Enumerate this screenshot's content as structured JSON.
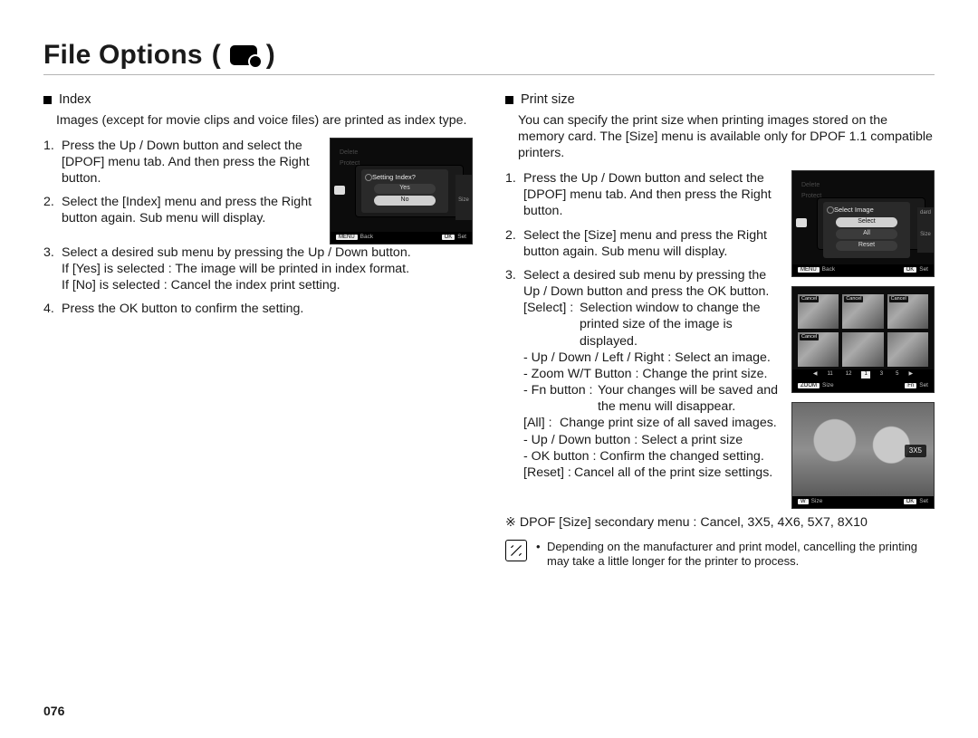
{
  "page_number": "076",
  "title": "File Options",
  "title_paren_open": "(",
  "title_paren_close": ")",
  "left": {
    "heading": "Index",
    "intro": "Images (except for movie clips and voice files) are printed as index type.",
    "s1": "Press the Up / Down button and select the [DPOF] menu tab. And then press the Right button.",
    "s2": "Select the [Index] menu and press the Right button again. Sub menu will display.",
    "s3": "Select a desired sub menu by pressing the Up / Down button.",
    "s3yes": "If [Yes] is selected : The image will be printed in index format.",
    "s3no": "If [No] is selected   : Cancel the index print setting.",
    "s4": "Press the OK button to confirm the setting.",
    "shot": {
      "faded1": "Delete",
      "faded2": "Protect",
      "dialog_title": "Setting Index?",
      "opt_yes": "Yes",
      "opt_no": "No",
      "right_label": "Size",
      "back": "Back",
      "set": "Set",
      "badge_menu": "MENU",
      "badge_ok": "OK"
    }
  },
  "right": {
    "heading": "Print size",
    "intro": "You can specify the print size when printing images stored on the memory card. The [Size] menu is available only for DPOF 1.1 compatible printers.",
    "s1": "Press the Up / Down button and select the [DPOF] menu tab. And then press the Right button.",
    "s2": "Select the [Size] menu and press the Right button again. Sub menu will display.",
    "s3": "Select a desired sub menu by pressing the Up / Down button and press the OK button.",
    "s3_select_label": "[Select] :",
    "s3_select_text": "Selection window to change the printed size of the image is displayed.",
    "s3_b1": "- Up / Down / Left / Right : Select an image.",
    "s3_b2": "- Zoom W/T Button : Change the print size.",
    "s3_b3_a": "- Fn button :",
    "s3_b3_b": "Your changes will be saved and the menu will disappear.",
    "s3_all_label": "[All] :",
    "s3_all_text": "Change print size of all saved images.",
    "s3_c1": "- Up / Down button : Select a print size",
    "s3_c2": "- OK button : Confirm the changed setting.",
    "s3_reset_label": "[Reset] :",
    "s3_reset_text": "Cancel all of the print size settings.",
    "secondary": "※ DPOF [Size] secondary menu : Cancel, 3X5, 4X6, 5X7, 8X10",
    "note": "Depending on the manufacturer and print model, cancelling the printing may take a little longer for the printer to process.",
    "shot1": {
      "faded1": "Delete",
      "faded2": "Protect",
      "dialog_title": "Select Image",
      "opt_select": "Select",
      "opt_all": "All",
      "opt_reset": "Reset",
      "right1": "dard",
      "right2": "Size",
      "back": "Back",
      "set": "Set",
      "badge_menu": "MENU",
      "badge_ok": "OK"
    },
    "shot2": {
      "badge": "Cancel",
      "pages": [
        "11",
        "12",
        "1",
        "3",
        "5"
      ],
      "size": "Size",
      "set": "Set",
      "badge_zoom": "ZOOM",
      "badge_fn": "Fn"
    },
    "shot3": {
      "chip": "3X5",
      "size": "Size",
      "set": "Set",
      "badge_zoom": "W",
      "badge_ok": "OK"
    }
  }
}
